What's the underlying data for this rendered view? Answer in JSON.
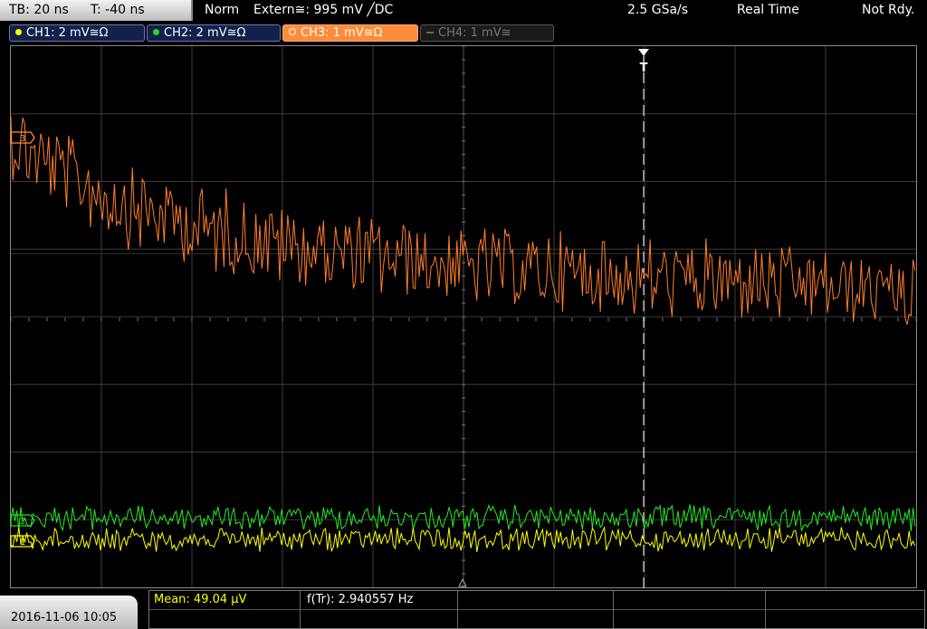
{
  "header": {
    "timebase": "TB: 20 ns",
    "trigger_pos": "T: -40 ns",
    "mode": "Norm",
    "trigger_source": "Extern≅: 995 mV ╱DC",
    "sample_rate": "2.5 GSa/s",
    "acquisition": "Real Time",
    "status": "Not Rdy."
  },
  "channels": [
    {
      "label": "CH1: 2 mV≅Ω",
      "color": "#ffff00"
    },
    {
      "label": "CH2: 2 mV≅Ω",
      "color": "#22dd22"
    },
    {
      "label": "CH3: 1 mV≅Ω",
      "color": "#ff8c3a"
    },
    {
      "label": "CH4: 1 mV≅",
      "color": "#777777"
    }
  ],
  "markers": {
    "trigger_top": "T",
    "ch3_ref": "3",
    "ch2_ref": "2",
    "ch1_ref": "1"
  },
  "footer": {
    "datetime": "2016-11-06 10:05",
    "mean": "Mean: 49.04 µV",
    "freq": "f(Tr): 2.940557 Hz"
  },
  "trace_colors": {
    "ch1": "#ffff00",
    "ch2": "#22ee22",
    "ch3": "#ff7f2a",
    "grid": "#3c3c3c",
    "trigger_line": "#ffffff"
  }
}
